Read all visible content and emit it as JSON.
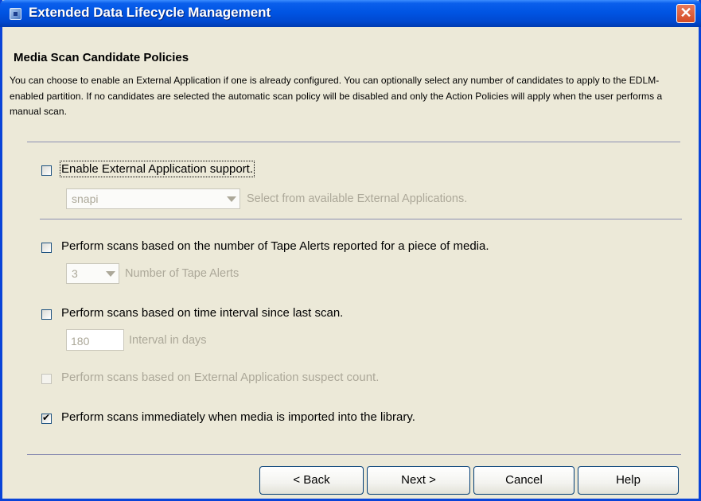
{
  "window": {
    "title": "Extended Data Lifecycle Management",
    "close_label": "✕"
  },
  "section": {
    "title": "Media Scan Candidate Policies",
    "description": "You can choose to enable an External Application if one is already configured. You can optionally select any number of candidates to apply to the EDLM-enabled partition. If no candidates are selected the automatic scan policy will be disabled and only the Action Policies will apply when the user performs a manual scan."
  },
  "options": {
    "external_app": {
      "label": "Enable External Application support.",
      "checked": false,
      "combo_value": "snapi",
      "hint": "Select from available External Applications."
    },
    "tape_alerts": {
      "label": "Perform scans based on the number of Tape Alerts reported for a piece of media.",
      "checked": false,
      "combo_value": "3",
      "hint": "Number of Tape Alerts"
    },
    "time_interval": {
      "label": "Perform scans based on time interval since last scan.",
      "checked": false,
      "value": "180",
      "hint": "Interval in days"
    },
    "suspect_count": {
      "label": "Perform scans based on External Application suspect count.",
      "checked": false,
      "disabled": true
    },
    "on_import": {
      "label": "Perform scans immediately when media is imported into the library.",
      "checked": true
    }
  },
  "buttons": {
    "back": "< Back",
    "next": "Next >",
    "cancel": "Cancel",
    "help": "Help"
  },
  "colors": {
    "titlebar": "#0054e3",
    "window_bg": "#ece9d8",
    "disabled_text": "#aca899",
    "close_button": "#d44b24"
  }
}
